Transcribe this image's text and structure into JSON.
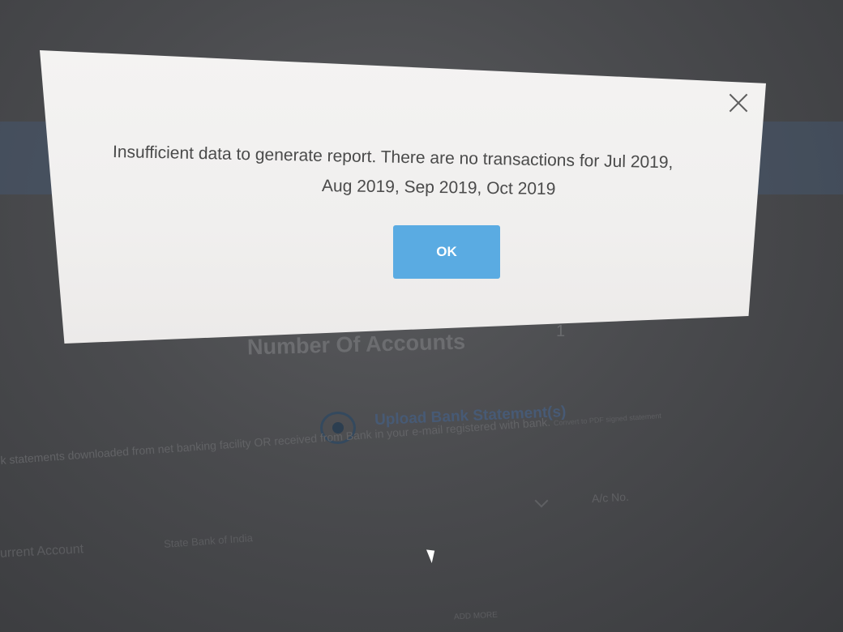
{
  "dialog": {
    "message_line1": "Insufficient data to generate report. There are no transactions for Jul 2019,",
    "message_line2": "Aug 2019, Sep 2019, Oct 2019",
    "ok_label": "OK",
    "close_icon": "close-icon",
    "button_color": "#5aabe2"
  },
  "background_page": {
    "accounts_title": "Number Of Accounts",
    "accounts_count": "1",
    "upload_option": {
      "label": "Upload Bank Statement(s)",
      "selected": true
    },
    "upload_description": "k statements downloaded from net banking facility OR received from Bank in your e-mail registered with bank.",
    "upload_description_tail": "Convert to PDF signed statement",
    "account_number_label": "A/c No.",
    "account_type": "urrent Account",
    "bank_name": "State Bank of India",
    "bottom_hint": "ADD MORE"
  }
}
